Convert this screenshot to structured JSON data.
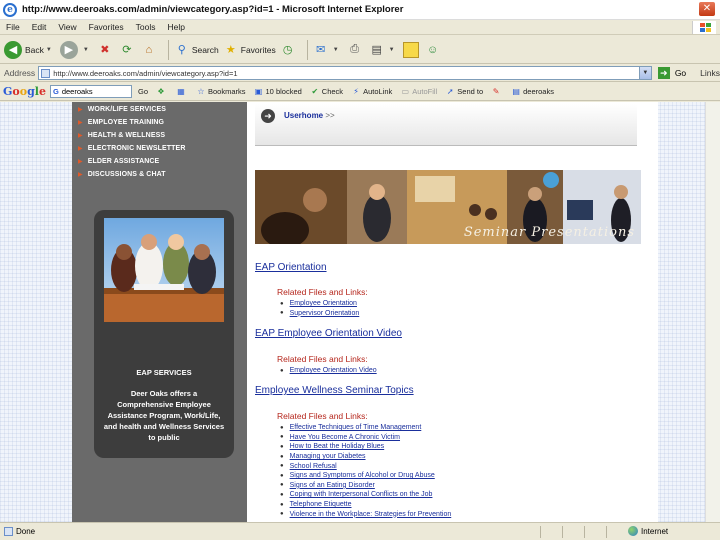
{
  "window": {
    "title": "http://www.deeroaks.com/admin/viewcategory.asp?id=1 - Microsoft Internet Explorer"
  },
  "menu": [
    "File",
    "Edit",
    "View",
    "Favorites",
    "Tools",
    "Help"
  ],
  "toolbar": {
    "back": "Back",
    "search": "Search",
    "favorites": "Favorites"
  },
  "address": {
    "label": "Address",
    "url": "http://www.deeroaks.com/admin/viewcategory.asp?id=1",
    "go": "Go",
    "links": "Links"
  },
  "google_toolbar": {
    "logo": "Google",
    "search_value": "deeroaks",
    "go": "Go",
    "bookmarks": "Bookmarks",
    "blocked": "10 blocked",
    "check": "Check",
    "autolink": "AutoLink",
    "autofill": "AutoFill",
    "send_to": "Send to",
    "deeroaks": "deeroaks"
  },
  "sidebar": {
    "items": [
      "WORK/LIFE SERVICES",
      "EMPLOYEE TRAINING",
      "HEALTH & WELLNESS",
      "ELECTRONIC NEWSLETTER",
      "ELDER ASSISTANCE",
      "DISCUSSIONS & CHAT"
    ],
    "eap_title": "EAP SERVICES",
    "eap_text": "Deer Oaks offers a Comprehensive Employee Assistance Program, Work/Life, and health and Wellness Services to public"
  },
  "breadcrumb": {
    "home": "Userhome",
    "sep": ">>"
  },
  "banner": {
    "caption": "Seminar Presentations"
  },
  "sections": [
    {
      "title": "EAP Orientation",
      "related": "Related Files and Links:",
      "links": [
        "Employee Orientation",
        "Supervisor Orientation"
      ]
    },
    {
      "title": "EAP Employee Orientation Video",
      "related": "Related Files and Links:",
      "links": [
        "Employee Orientation Video"
      ]
    },
    {
      "title": "Employee Wellness Seminar Topics",
      "related": "Related Files and Links:",
      "links": [
        "Effective Techniques of Time Management",
        "Have You Become A Chronic Victim",
        "How to Beat the Holiday Blues",
        "Managing your Diabetes",
        "School Refusal",
        "Signs and Symptoms of Alcohol or Drug Abuse",
        "Signs of an Eating Disorder",
        "Coping with Interpersonal Conflicts on the Job",
        "Telephone Etiquette",
        "Violence in the Workplace: Strategies for Prevention"
      ]
    }
  ],
  "status": {
    "left": "Done",
    "zone": "Internet"
  }
}
